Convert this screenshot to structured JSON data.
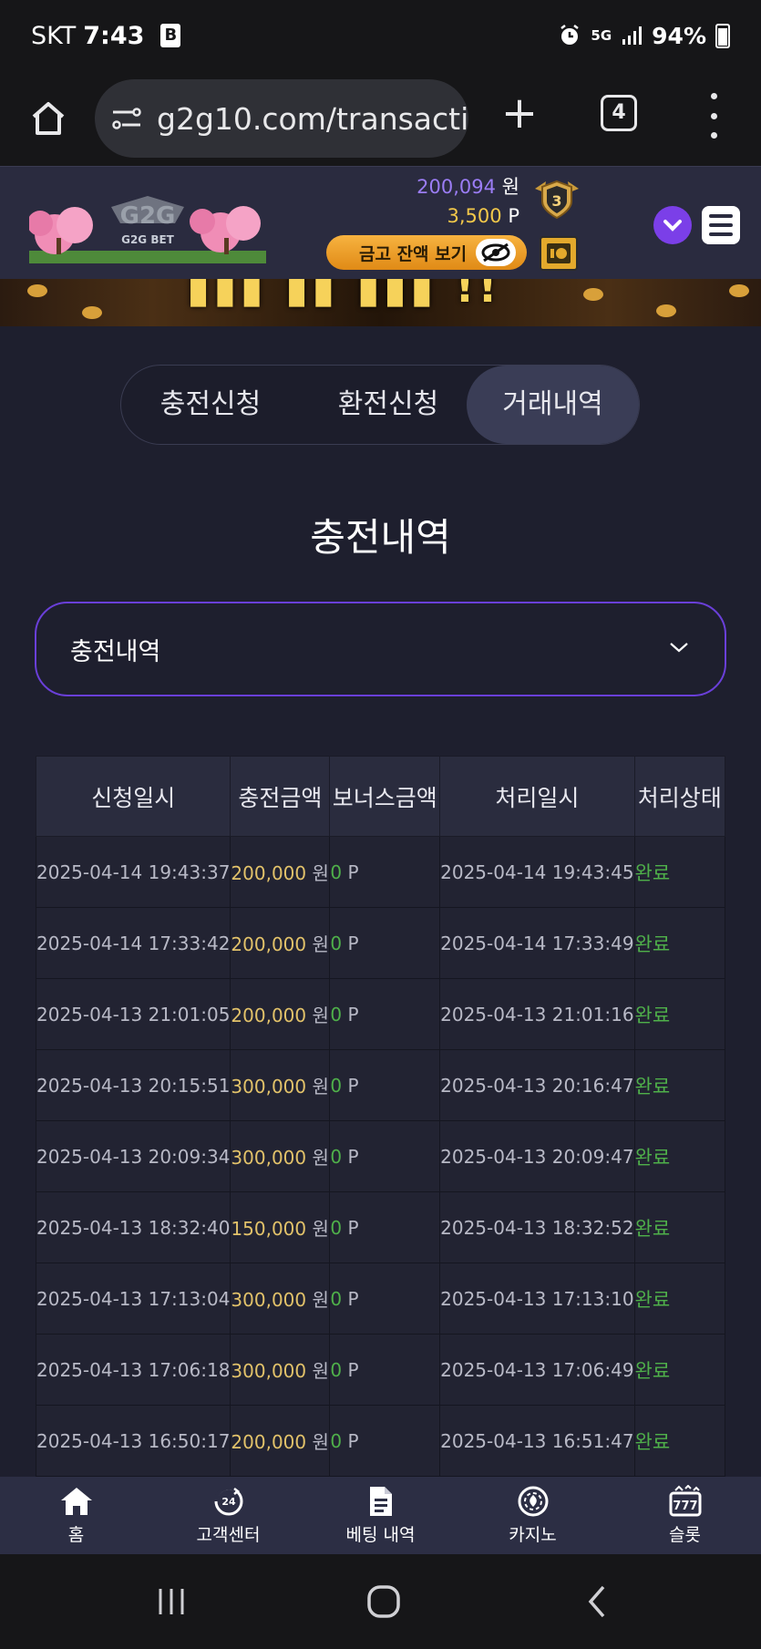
{
  "status_bar": {
    "carrier": "SKT",
    "time": "7:43",
    "badge": "B",
    "network": "5G",
    "battery": "94%"
  },
  "browser": {
    "url": "g2g10.com/transacti",
    "tab_count": "4"
  },
  "header": {
    "logo_text": "G2G BET",
    "balance_won_value": "200,094",
    "balance_won_unit": "원",
    "balance_point_value": "3,500",
    "balance_point_unit": "P",
    "level": "3",
    "vault_button_label": "금고 잔액 보기"
  },
  "tabs": [
    {
      "label": "충전신청",
      "active": false
    },
    {
      "label": "환전신청",
      "active": false
    },
    {
      "label": "거래내역",
      "active": true
    }
  ],
  "section_title": "충전내역",
  "filter_select": {
    "value": "충전내역"
  },
  "table": {
    "headers": [
      "신청일시",
      "충전금액",
      "보너스금액",
      "처리일시",
      "처리상태"
    ],
    "won_unit": "원",
    "point_unit": "P",
    "rows": [
      {
        "requested": "2025-04-14 19:43:37",
        "amount": "200,000",
        "bonus": "0",
        "processed": "2025-04-14 19:43:45",
        "status": "완료"
      },
      {
        "requested": "2025-04-14 17:33:42",
        "amount": "200,000",
        "bonus": "0",
        "processed": "2025-04-14 17:33:49",
        "status": "완료"
      },
      {
        "requested": "2025-04-13 21:01:05",
        "amount": "200,000",
        "bonus": "0",
        "processed": "2025-04-13 21:01:16",
        "status": "완료"
      },
      {
        "requested": "2025-04-13 20:15:51",
        "amount": "300,000",
        "bonus": "0",
        "processed": "2025-04-13 20:16:47",
        "status": "완료"
      },
      {
        "requested": "2025-04-13 20:09:34",
        "amount": "300,000",
        "bonus": "0",
        "processed": "2025-04-13 20:09:47",
        "status": "완료"
      },
      {
        "requested": "2025-04-13 18:32:40",
        "amount": "150,000",
        "bonus": "0",
        "processed": "2025-04-13 18:32:52",
        "status": "완료"
      },
      {
        "requested": "2025-04-13 17:13:04",
        "amount": "300,000",
        "bonus": "0",
        "processed": "2025-04-13 17:13:10",
        "status": "완료"
      },
      {
        "requested": "2025-04-13 17:06:18",
        "amount": "300,000",
        "bonus": "0",
        "processed": "2025-04-13 17:06:49",
        "status": "완료"
      },
      {
        "requested": "2025-04-13 16:50:17",
        "amount": "200,000",
        "bonus": "0",
        "processed": "2025-04-13 16:51:47",
        "status": "완료"
      }
    ]
  },
  "bottom_nav": [
    {
      "label": "홈",
      "icon": "home-icon"
    },
    {
      "label": "고객센터",
      "icon": "support-24-icon"
    },
    {
      "label": "베팅 내역",
      "icon": "document-icon"
    },
    {
      "label": "카지노",
      "icon": "casino-chip-icon"
    },
    {
      "label": "슬롯",
      "icon": "slot-777-icon"
    }
  ],
  "colors": {
    "background": "#1e1f2e",
    "accent_purple": "#7b3fe8",
    "amount_gold": "#e2c26a",
    "status_green": "#4fb04a"
  }
}
